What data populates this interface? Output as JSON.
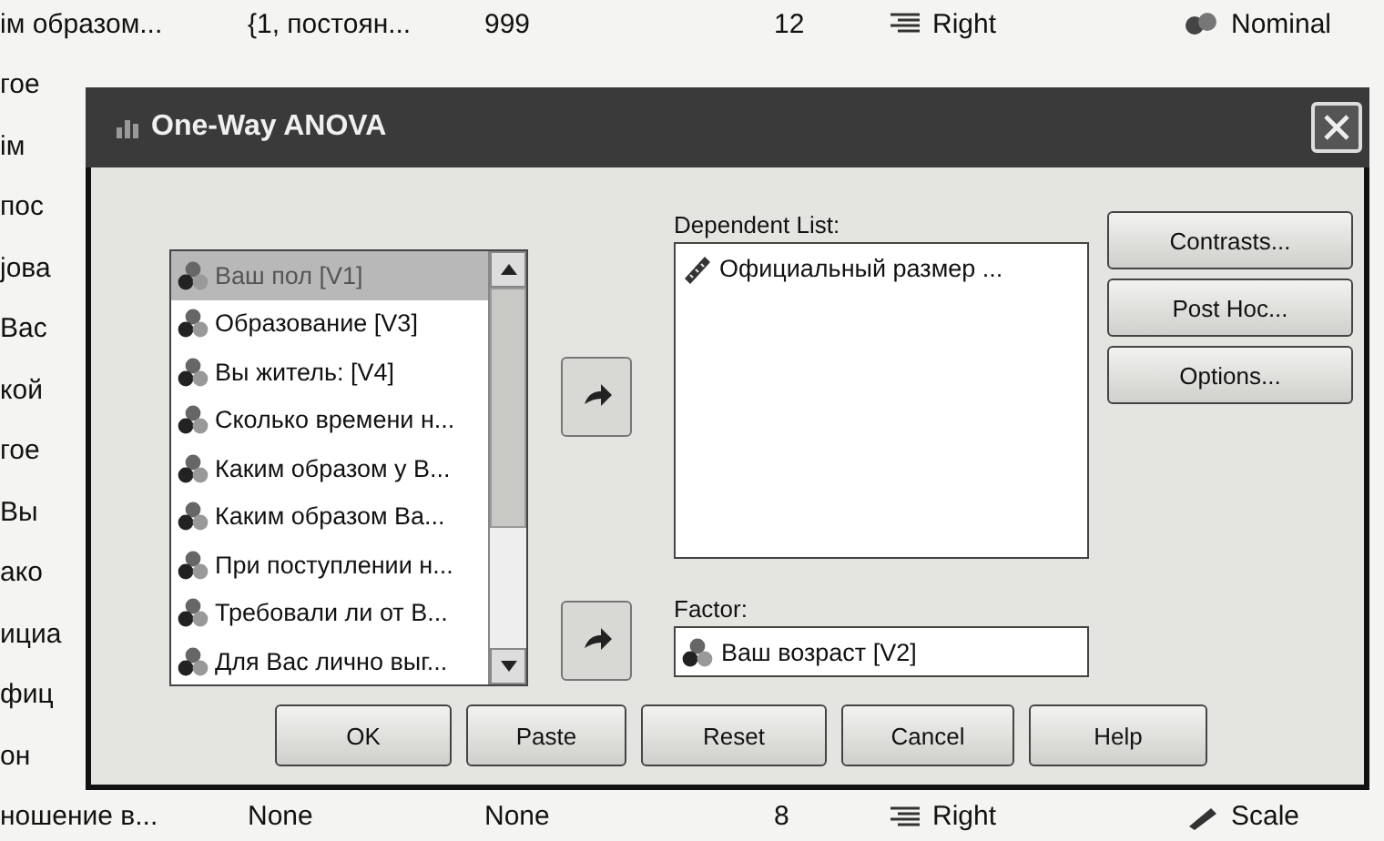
{
  "data_view": {
    "rows": [
      {
        "cells": [
          "ім образом...",
          "{1, постоян...",
          "999",
          "12"
        ],
        "align": "Right",
        "measure": "Nominal",
        "kind": "nominal"
      },
      {
        "cells": [
          "гое"
        ]
      },
      {
        "cells": [
          "ім"
        ]
      },
      {
        "cells": [
          "пос"
        ]
      },
      {
        "cells": [
          "јова"
        ]
      },
      {
        "cells": [
          "Вас"
        ]
      },
      {
        "cells": [
          "кой"
        ]
      },
      {
        "cells": [
          "гое"
        ]
      },
      {
        "cells": [
          "Вы"
        ]
      },
      {
        "cells": [
          "ако"
        ]
      },
      {
        "cells": [
          "ициа"
        ]
      },
      {
        "cells": [
          "фиц"
        ]
      },
      {
        "cells": [
          "он"
        ]
      },
      {
        "cells": [
          "ношение в...",
          "None",
          "None",
          "8"
        ],
        "align": "Right",
        "measure": "Scale",
        "kind": "scale"
      }
    ]
  },
  "dialog": {
    "title": "One-Way ANOVA",
    "variables": [
      {
        "label": "Ваш пол [V1]",
        "selected": true
      },
      {
        "label": "Образование [V3]",
        "selected": false
      },
      {
        "label": "Вы житель: [V4]",
        "selected": false
      },
      {
        "label": "Сколько времени н...",
        "selected": false
      },
      {
        "label": "Каким образом у В...",
        "selected": false
      },
      {
        "label": "Каким образом Ва...",
        "selected": false
      },
      {
        "label": "При поступлении н...",
        "selected": false
      },
      {
        "label": "Требовали ли от В...",
        "selected": false
      },
      {
        "label": "Для Вас лично выг...",
        "selected": false
      }
    ],
    "dependent_label": "Dependent List:",
    "dependent_items": [
      "Официальный размер ..."
    ],
    "factor_label": "Factor:",
    "factor_value": "Ваш возраст [V2]",
    "side_buttons": [
      "Contrasts...",
      "Post Hoc...",
      "Options..."
    ],
    "buttons": [
      "OK",
      "Paste",
      "Reset",
      "Cancel",
      "Help"
    ]
  }
}
